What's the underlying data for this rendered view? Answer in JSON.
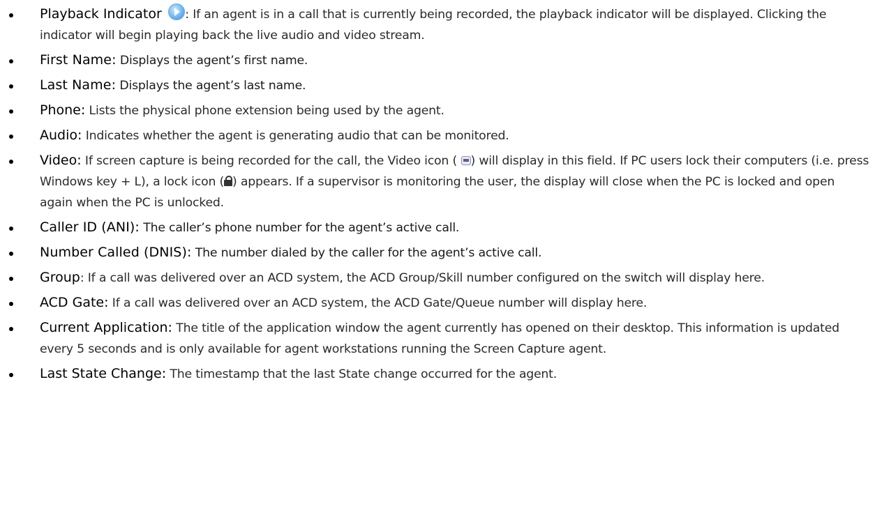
{
  "items": [
    {
      "term": "Playback Indicator",
      "icon": "play-icon",
      "desc": ": If an agent is in a call that is currently being recorded, the playback indicator will be displayed. Clicking the indicator will begin playing back the live audio and video stream."
    },
    {
      "term": "First Name:",
      "desc": " Displays the agent’s first name."
    },
    {
      "term": "Last Name:",
      "desc": " Displays the agent’s last name."
    },
    {
      "term": "Phone:",
      "desc": " Lists the physical phone extension being used by the agent."
    },
    {
      "term": "Audio:",
      "desc": " Indicates whether the agent is generating audio that can be monitored."
    },
    {
      "term": "Video:",
      "desc_a": " If screen capture is being recorded for the call, the Video icon (",
      "icon_a": "video-icon",
      "desc_b": ") will display in this field. If PC users lock their computers (i.e. press Windows key + L), a lock icon (",
      "icon_b": "lock-icon",
      "desc_c": ") appears. If a supervisor is monitoring the user, the display will close when the PC is locked and open again when the PC is unlocked."
    },
    {
      "term": "Caller ID (ANI):",
      "desc": " The caller’s phone number for the agent’s active call."
    },
    {
      "term": "Number Called (DNIS):",
      "desc": " The number dialed by the caller for the agent’s active call."
    },
    {
      "term": "Group",
      "desc": ": If a call was delivered over an ACD system, the ACD Group/Skill number configured on the switch will display here."
    },
    {
      "term": "ACD Gate:",
      "desc": " If a call was delivered over an ACD system, the ACD Gate/Queue number will display here."
    },
    {
      "term": "Current Application:",
      "desc": " The title of the application window the agent currently has opened on their desktop. This information is updated every 5 seconds and is only available for agent workstations running the Screen Capture agent."
    },
    {
      "term": "Last State Change:",
      "desc": " The timestamp that the last State change occurred for the agent."
    }
  ]
}
